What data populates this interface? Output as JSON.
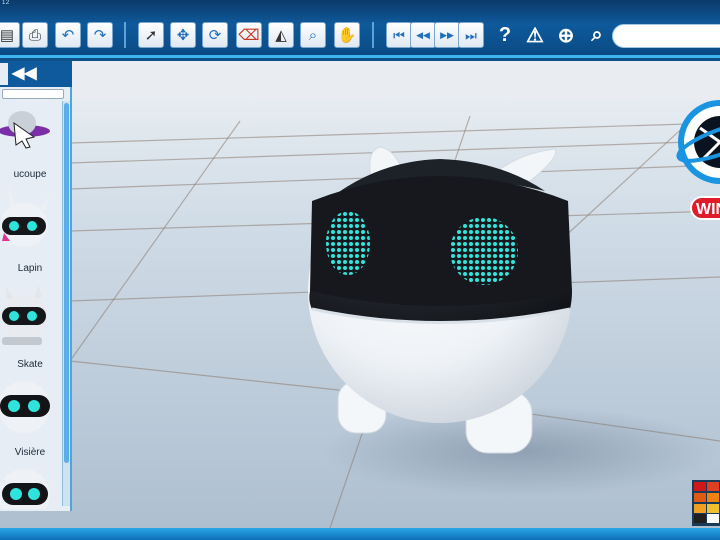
{
  "window": {
    "title_fragment": "12"
  },
  "toolbar": {
    "buttons": [
      {
        "name": "save-button",
        "glyph": "▤"
      },
      {
        "name": "print-button",
        "glyph": "⎙"
      },
      {
        "name": "undo-button",
        "glyph": "↶"
      },
      {
        "name": "redo-button",
        "glyph": "↷"
      },
      {
        "name": "select-tool-button",
        "glyph": "➚"
      },
      {
        "name": "move-tool-button",
        "glyph": "✥"
      },
      {
        "name": "rotate-tool-button",
        "glyph": "⟳"
      },
      {
        "name": "eraser-tool-button",
        "glyph": "⌫"
      },
      {
        "name": "paint-tool-button",
        "glyph": "◭"
      },
      {
        "name": "zoom-tool-button",
        "glyph": "⌕"
      },
      {
        "name": "pan-tool-button",
        "glyph": "✋"
      },
      {
        "name": "first-frame-button",
        "glyph": "⏮"
      },
      {
        "name": "prev-frame-button",
        "glyph": "◀◀"
      },
      {
        "name": "next-frame-button",
        "glyph": "▶▶"
      },
      {
        "name": "last-frame-button",
        "glyph": "⏭"
      }
    ],
    "help_glyph": "?",
    "warning_glyph": "⚠",
    "globe_glyph": "⊕",
    "search_glyph": "⌕",
    "search_value": ""
  },
  "panel": {
    "collapse_glyph": "◀◀",
    "items": [
      {
        "label": "ucoupe"
      },
      {
        "label": "Lapin"
      },
      {
        "label": "Skate"
      },
      {
        "label": "Visière"
      },
      {
        "label": ""
      }
    ]
  },
  "brand": {
    "text": "WIN"
  },
  "palette": {
    "colors": [
      "#d01818",
      "#e04020",
      "#e05a10",
      "#f08010",
      "#f0a020",
      "#f0c030",
      "#202020",
      "#ffffff"
    ]
  },
  "scene": {
    "robot_eye_color": "#29e0d8",
    "robot_body_color": "#f4f6f8",
    "robot_visor_color": "#1a1d22"
  }
}
